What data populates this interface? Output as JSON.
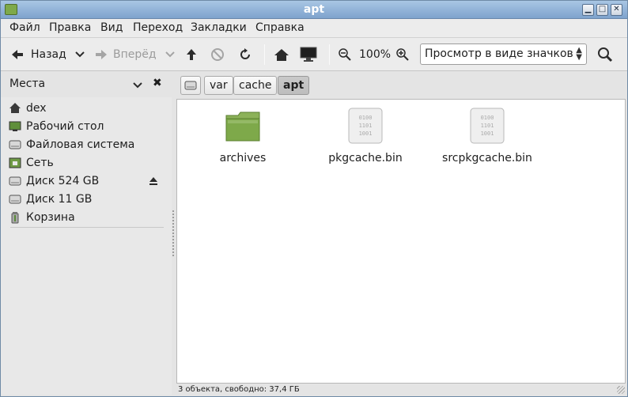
{
  "window": {
    "title": "apt",
    "controls": {
      "minimize": "▁",
      "maximize": "□",
      "close": "✕"
    }
  },
  "menu": [
    "Файл",
    "Правка",
    "Вид",
    "Переход",
    "Закладки",
    "Справка"
  ],
  "toolbar": {
    "back_label": "Назад",
    "forward_label": "Вперёд",
    "zoom_level": "100%",
    "view_mode": "Просмотр в виде значков"
  },
  "sidebar": {
    "header": "Места",
    "items": [
      {
        "label": "dex",
        "icon": "home-icon"
      },
      {
        "label": "Рабочий стол",
        "icon": "desktop-icon"
      },
      {
        "label": "Файловая система",
        "icon": "drive-icon"
      },
      {
        "label": "Сеть",
        "icon": "network-icon"
      },
      {
        "label": "Диск 524 GB",
        "icon": "drive-icon"
      },
      {
        "label": "Диск 11 GB",
        "icon": "drive-icon"
      },
      {
        "label": "Корзина",
        "icon": "trash-icon"
      }
    ]
  },
  "path": [
    "var",
    "cache",
    "apt"
  ],
  "files": [
    {
      "name": "archives",
      "icon": "folder-icon"
    },
    {
      "name": "pkgcache.bin",
      "icon": "binary-file-icon",
      "glyph": "0100\n1101\n1001"
    },
    {
      "name": "srcpkgcache.bin",
      "icon": "binary-file-icon",
      "glyph": "0100\n1101\n1001"
    }
  ],
  "status": "3 объекта, свободно: 37,4 ГБ",
  "colors": {
    "titlebar": "#8fb1d8",
    "folder": "#7ea94a",
    "accent": "#6f8aa6"
  }
}
